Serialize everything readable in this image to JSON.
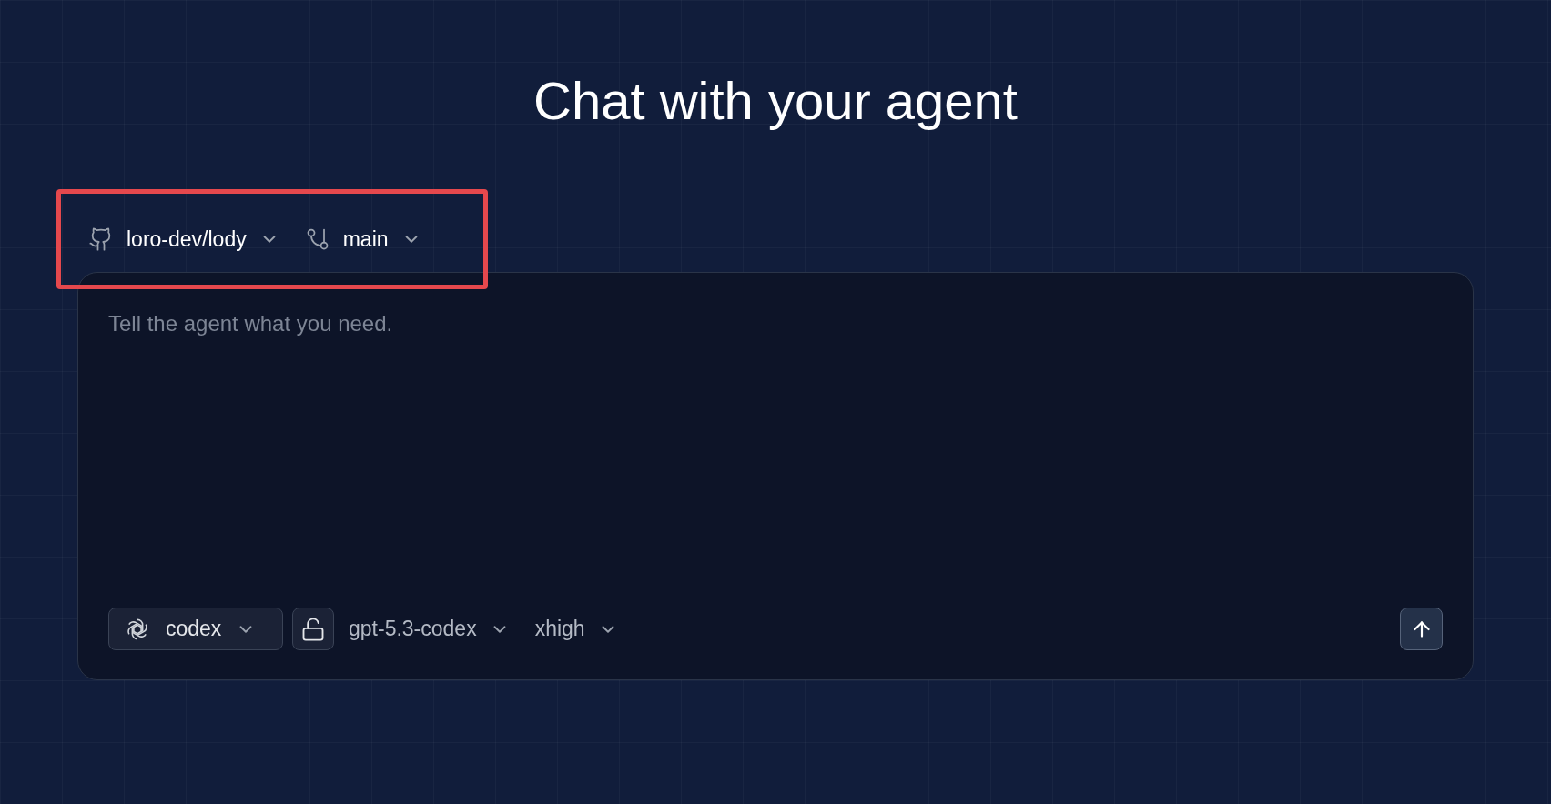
{
  "title": "Chat with your agent",
  "repo_bar": {
    "highlighted": true,
    "repo": "loro-dev/lody",
    "branch": "main"
  },
  "composer": {
    "placeholder": "Tell the agent what you need.",
    "agent": "codex",
    "locked": false,
    "model": "gpt-5.3-codex",
    "effort": "xhigh"
  }
}
